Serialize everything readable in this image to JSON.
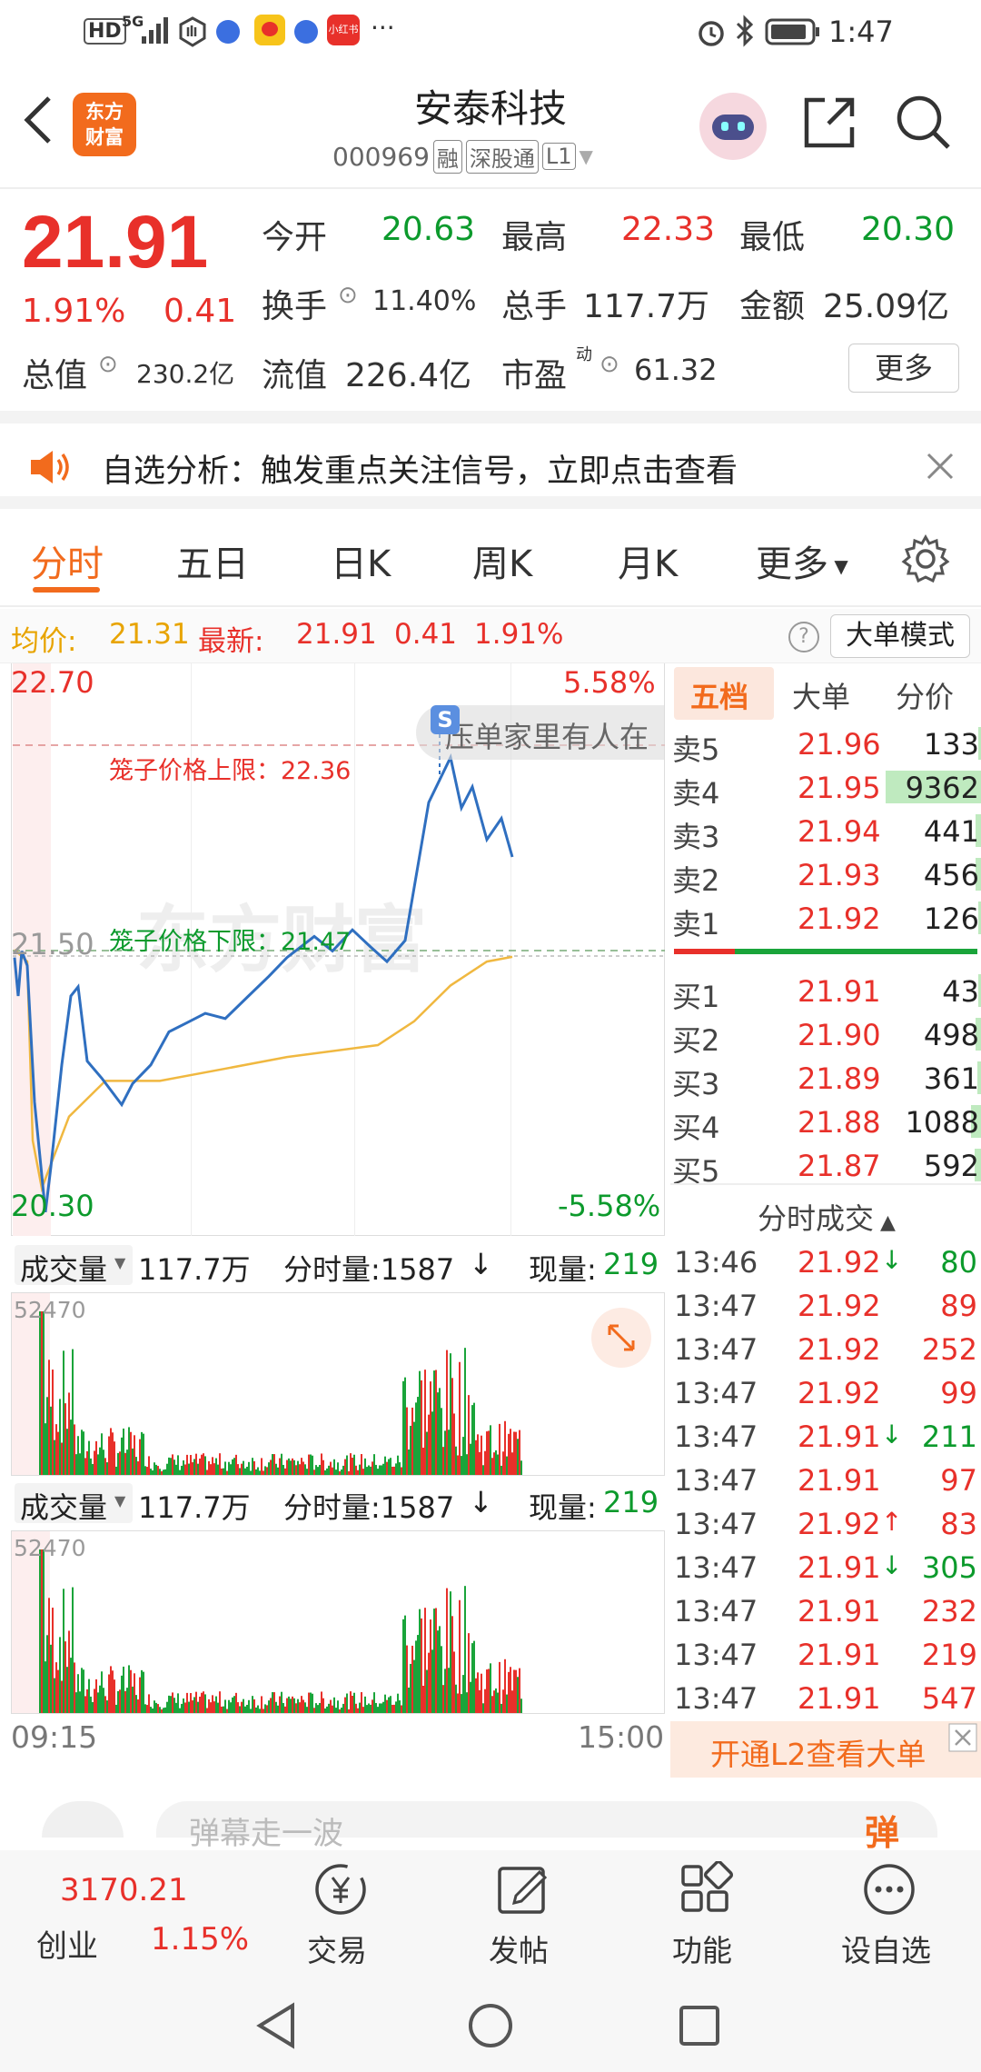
{
  "status": {
    "time": "1:47",
    "hd": "HD",
    "net": "5G",
    "more": "···"
  },
  "header": {
    "title": "安泰科技",
    "code": "000969",
    "badges": [
      "融",
      "深股通",
      "L1"
    ],
    "logo_line1": "东方",
    "logo_line2": "财富"
  },
  "quote": {
    "price": "21.91",
    "pct": "1.91%",
    "chg": "0.41",
    "open_label": "今开",
    "open": "20.63",
    "high_label": "最高",
    "high": "22.33",
    "low_label": "最低",
    "low": "20.30",
    "turnover_label": "换手",
    "turnover": "11.40%",
    "volume_label": "总手",
    "volume": "117.7万",
    "amount_label": "金额",
    "amount": "25.09亿",
    "mcap_label": "总值",
    "mcap": "230.2亿",
    "float_label": "流值",
    "float": "226.4亿",
    "pe_label": "市盈",
    "pe_sup": "动",
    "pe": "61.32",
    "more_label": "更多"
  },
  "notice": {
    "text": "自选分析：触发重点关注信号，立即点击查看"
  },
  "tabs": [
    "分时",
    "五日",
    "日K",
    "周K",
    "月K",
    "更多"
  ],
  "avgline": {
    "avg_label": "均价:",
    "avg": "21.31",
    "last_label": "最新:",
    "last": "21.91",
    "chg": "0.41",
    "pct": "1.91%",
    "mode": "大单模式"
  },
  "chart": {
    "y_top": "22.70",
    "y_mid": "21.50",
    "y_bot": "20.30",
    "pct_top": "5.58%",
    "pct_bot": "-5.58%",
    "upper_limit": "笼子价格上限：22.36",
    "lower_limit": "笼子价格下限：21.47",
    "danmu": "压单家里有人在",
    "danmu_badge": "S",
    "watermark": "东方财富",
    "time_start": "09:15",
    "time_end": "15:00",
    "vol_label": "成交量",
    "vol_total": "117.7万",
    "vol_fen": "分时量:1587",
    "vol_now_label": "现量:",
    "vol_now": "219",
    "vol_max": "52470"
  },
  "book": {
    "tabs": [
      "五档",
      "大单",
      "分价"
    ],
    "asks": [
      {
        "label": "卖5",
        "price": "21.96",
        "vol": "133",
        "bar": 0.03
      },
      {
        "label": "卖4",
        "price": "21.95",
        "vol": "9362",
        "bar": 0.95
      },
      {
        "label": "卖3",
        "price": "21.94",
        "vol": "441",
        "bar": 0.05
      },
      {
        "label": "卖2",
        "price": "21.93",
        "vol": "456",
        "bar": 0.05
      },
      {
        "label": "卖1",
        "price": "21.92",
        "vol": "126",
        "bar": 0.03
      }
    ],
    "bids": [
      {
        "label": "买1",
        "price": "21.91",
        "vol": "43",
        "bar": 0.02
      },
      {
        "label": "买2",
        "price": "21.90",
        "vol": "498",
        "bar": 0.05
      },
      {
        "label": "买3",
        "price": "21.89",
        "vol": "361",
        "bar": 0.04
      },
      {
        "label": "买4",
        "price": "21.88",
        "vol": "1088",
        "bar": 0.1
      },
      {
        "label": "买5",
        "price": "21.87",
        "vol": "592",
        "bar": 0.06
      }
    ],
    "trades_title": "分时成交",
    "trades": [
      {
        "t": "13:46",
        "p": "21.92",
        "d": "↓",
        "v": "80",
        "c": "green"
      },
      {
        "t": "13:47",
        "p": "21.92",
        "d": "",
        "v": "89",
        "c": "red"
      },
      {
        "t": "13:47",
        "p": "21.92",
        "d": "",
        "v": "252",
        "c": "red"
      },
      {
        "t": "13:47",
        "p": "21.92",
        "d": "",
        "v": "99",
        "c": "red"
      },
      {
        "t": "13:47",
        "p": "21.91",
        "d": "↓",
        "v": "211",
        "c": "green"
      },
      {
        "t": "13:47",
        "p": "21.91",
        "d": "",
        "v": "97",
        "c": "red"
      },
      {
        "t": "13:47",
        "p": "21.92",
        "d": "↑",
        "v": "83",
        "c": "red"
      },
      {
        "t": "13:47",
        "p": "21.91",
        "d": "↓",
        "v": "305",
        "c": "green"
      },
      {
        "t": "13:47",
        "p": "21.91",
        "d": "",
        "v": "232",
        "c": "red"
      },
      {
        "t": "13:47",
        "p": "21.91",
        "d": "",
        "v": "219",
        "c": "red"
      },
      {
        "t": "13:47",
        "p": "21.91",
        "d": "",
        "v": "547",
        "c": "red"
      }
    ],
    "l2_text": "开通L2查看大单"
  },
  "comment": {
    "placeholder": "弹幕走一波",
    "btn": "弹"
  },
  "bottom": {
    "index_value": "3170.21",
    "index_name": "创业",
    "index_pct": "1.15%",
    "items": [
      "交易",
      "发帖",
      "功能",
      "设自选"
    ]
  }
}
